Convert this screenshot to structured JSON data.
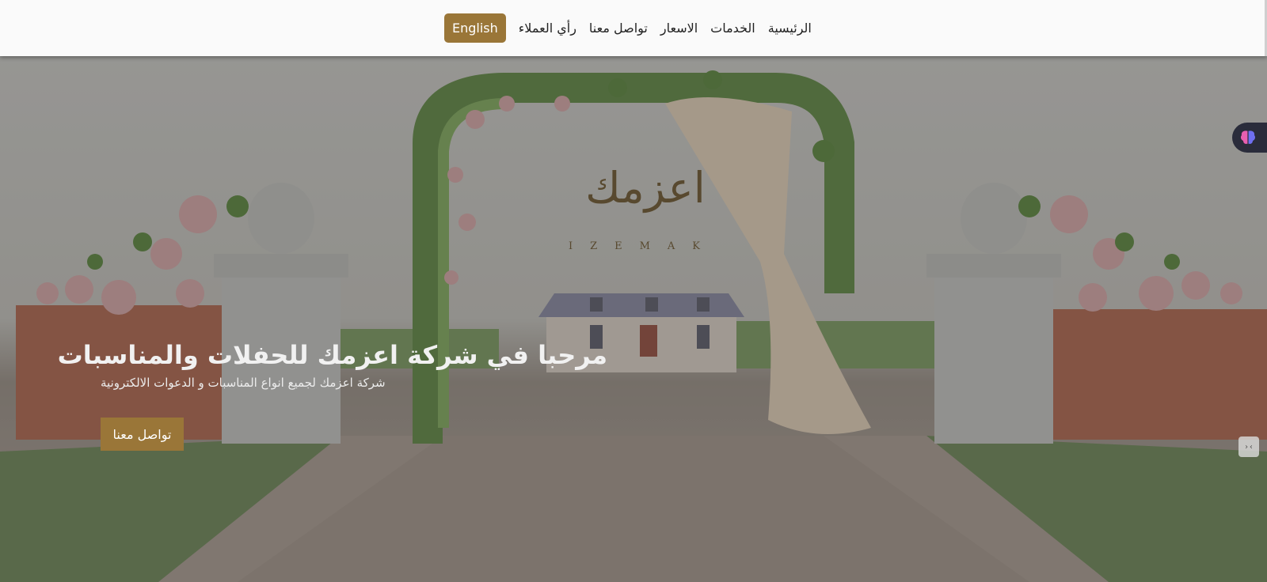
{
  "nav": {
    "items": [
      "الرئيسية",
      "الخدمات",
      "الاسعار",
      "تواصل معنا",
      "رأي العملاء"
    ],
    "lang_button": "English"
  },
  "hero": {
    "title": "مرحبا في شركة اعزمك للحفلات والمناسبات",
    "subtitle": "شركة اعزمك لجميع انواع المناسبات و الدعوات الالكترونية",
    "cta": "تواصل معنا",
    "logo_arabic": "اعزمك",
    "logo_latin": "IZEMAK"
  },
  "colors": {
    "accent": "#9a7638",
    "header_bg": "#fafafa"
  },
  "widgets": {
    "brain": "brain-icon",
    "code": "code-icon",
    "code_glyph": "›‹"
  }
}
